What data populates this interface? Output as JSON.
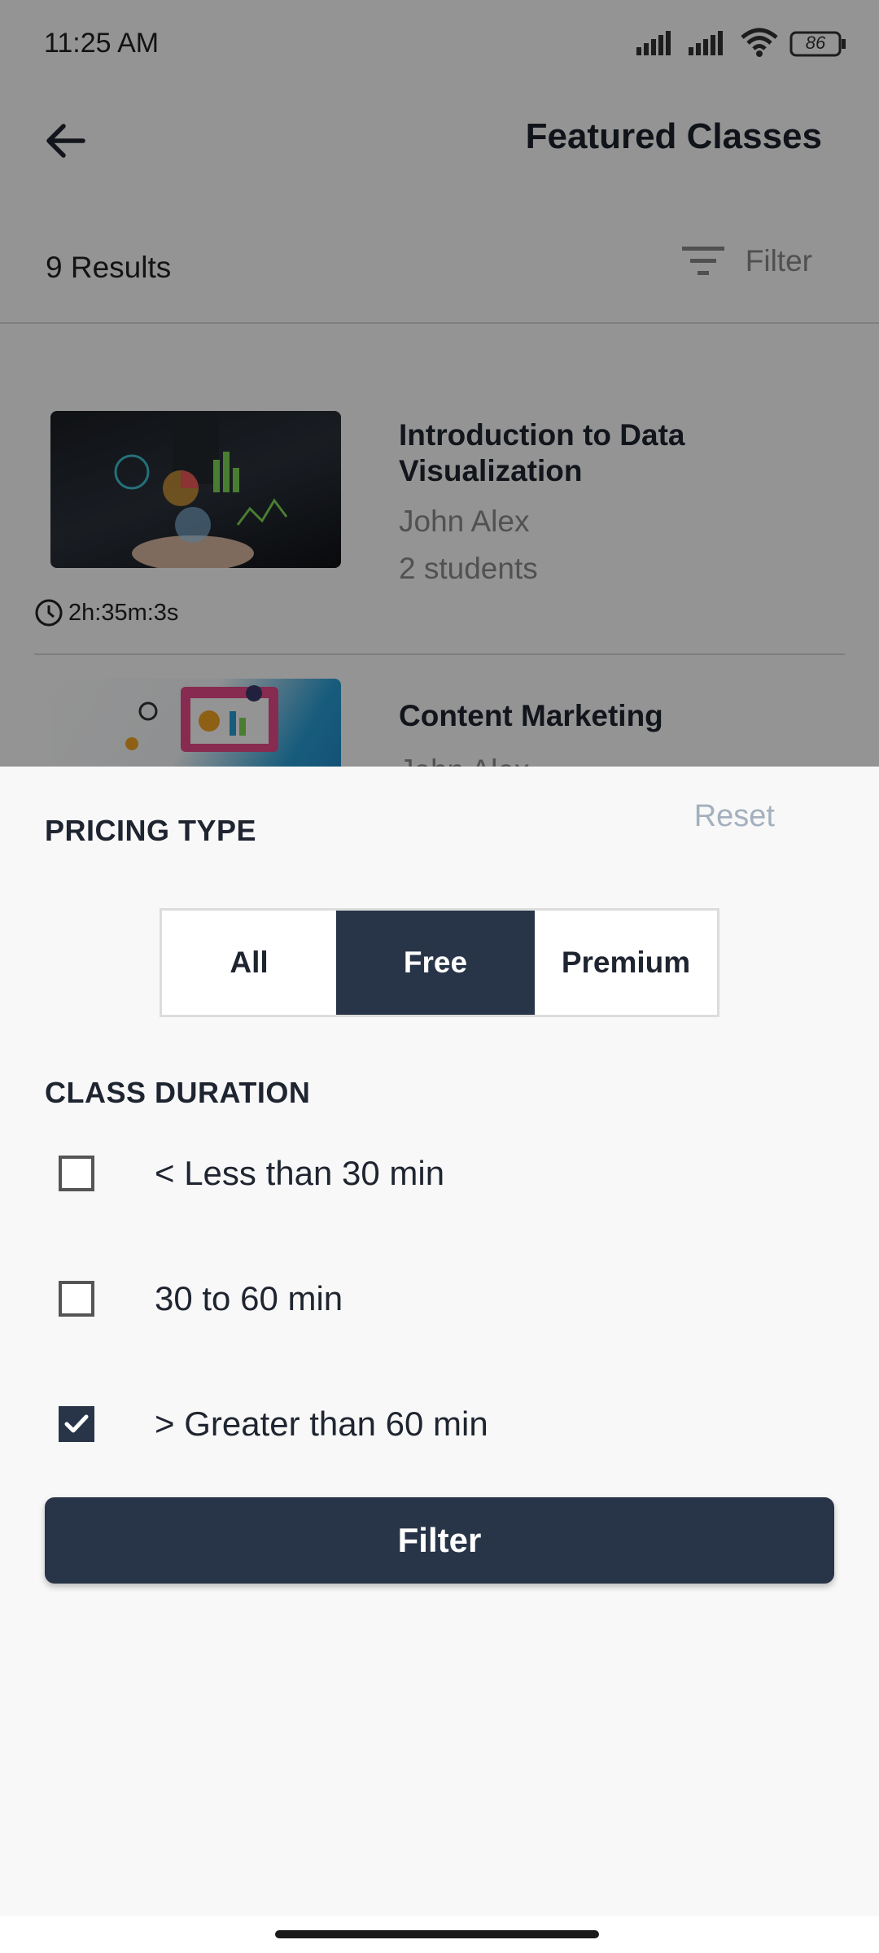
{
  "status_bar": {
    "time": "11:25 AM",
    "battery": "86"
  },
  "header": {
    "title": "Featured Classes",
    "back_icon": "arrow-back-icon"
  },
  "results": {
    "count_label": "9 Results",
    "filter_label": "Filter",
    "filter_icon": "filter-list-icon"
  },
  "courses": [
    {
      "title_line1": "Introduction to Data",
      "title_line2": "Visualization",
      "instructor": "John Alex",
      "students": "2 students",
      "duration": "2h:35m:3s"
    },
    {
      "title_line1": "Content Marketing",
      "instructor": "John Alex"
    }
  ],
  "filter_sheet": {
    "pricing_title": "PRICING TYPE",
    "reset_label": "Reset",
    "pricing_options": [
      "All",
      "Free",
      "Premium"
    ],
    "pricing_selected": "Free",
    "duration_title": "CLASS DURATION",
    "duration_options": [
      {
        "label": "< Less than 30 min",
        "checked": false
      },
      {
        "label": "30 to 60 min",
        "checked": false
      },
      {
        "label": "> Greater than 60 min",
        "checked": true
      }
    ],
    "submit_label": "Filter"
  },
  "colors": {
    "primary": "#283447",
    "sheet_bg": "#f8f8f9",
    "reset_text": "#a3b0bd"
  }
}
